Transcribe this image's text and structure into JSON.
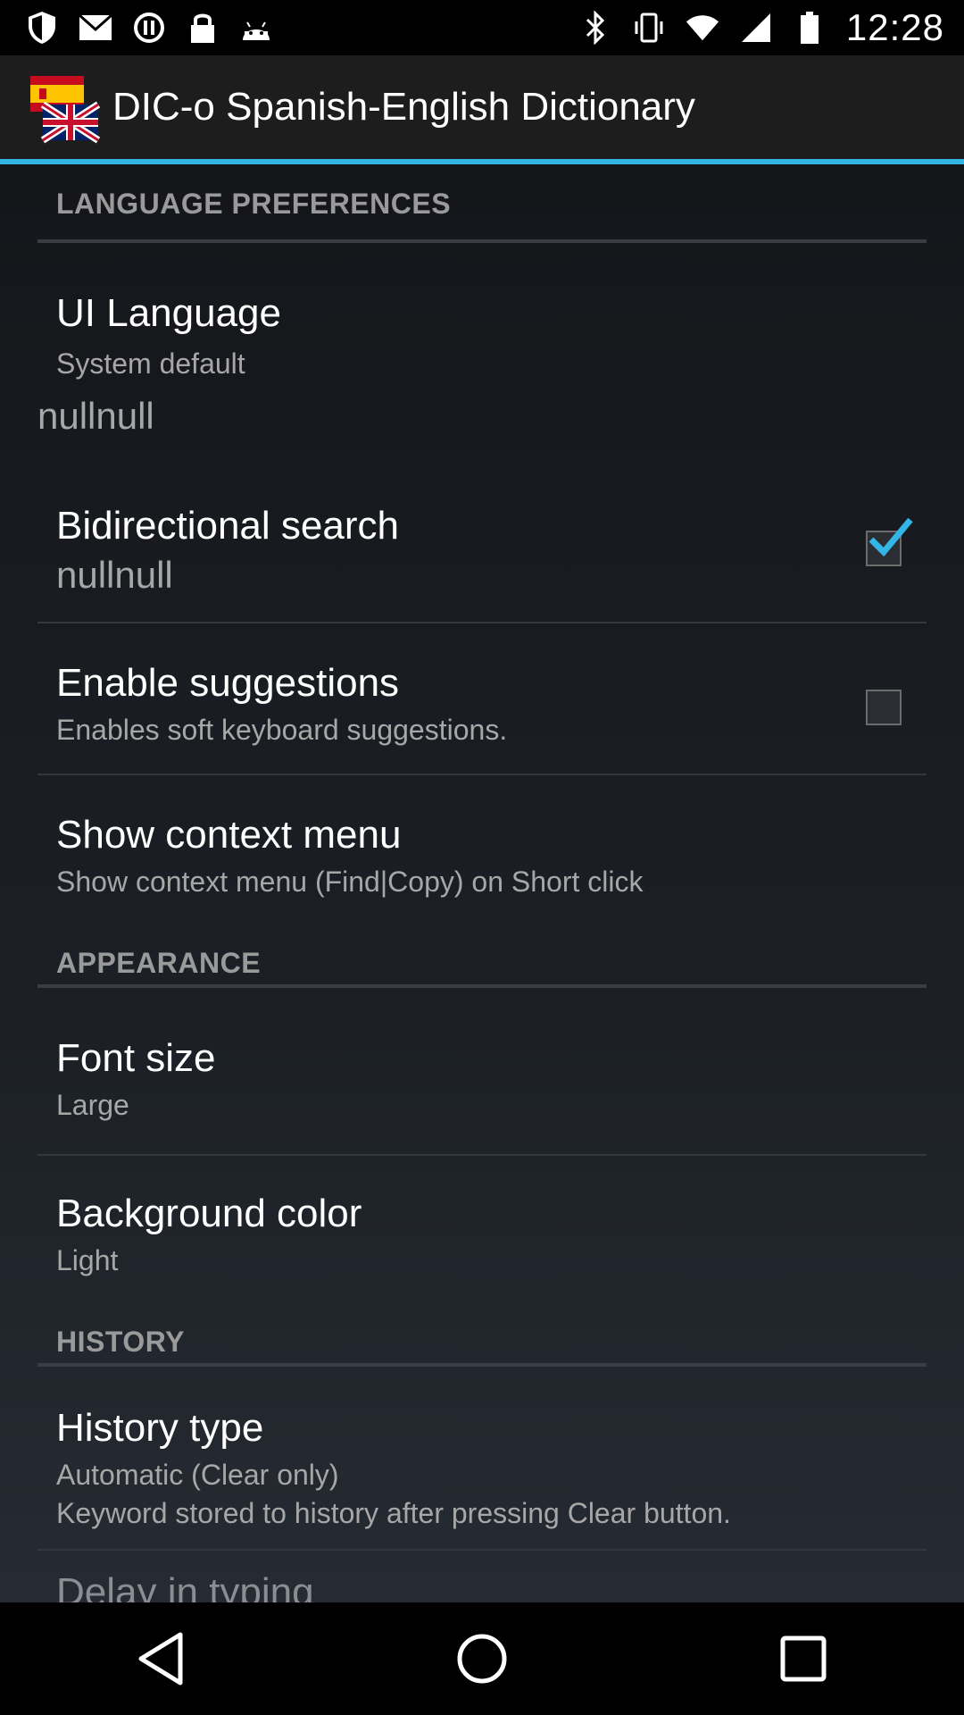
{
  "status_bar": {
    "time": "12:28",
    "left_icons": [
      "shield-icon",
      "gmail-icon",
      "sync-icon",
      "lock-icon",
      "android-icon"
    ],
    "right_icons": [
      "bluetooth-icon",
      "vibrate-icon",
      "wifi-icon",
      "signal-icon",
      "battery-icon"
    ]
  },
  "app_bar": {
    "title": "DIC-o Spanish-English Dictionary",
    "icon": "flags-icon",
    "accent": "#33b5e5"
  },
  "sections": {
    "language": {
      "header": "LANGUAGE PREFERENCES",
      "ui_language": {
        "title": "UI Language",
        "summary": "System default"
      },
      "nullnull_row": {
        "text": "nullnull"
      },
      "bidirectional": {
        "title": "Bidirectional search",
        "summary": "nullnull",
        "checked": true
      },
      "suggestions": {
        "title": "Enable suggestions",
        "summary": "Enables soft keyboard suggestions.",
        "checked": false
      },
      "context_menu": {
        "title": "Show context menu",
        "summary": "Show context menu (Find|Copy) on Short click"
      }
    },
    "appearance": {
      "header": "APPEARANCE",
      "font_size": {
        "title": "Font size",
        "summary": "Large"
      },
      "background_color": {
        "title": "Background color",
        "summary": "Light"
      }
    },
    "history": {
      "header": "HISTORY",
      "history_type": {
        "title": "History type",
        "summary_line1": "Automatic (Clear only)",
        "summary_line2": "Keyword stored to history after pressing Clear button."
      },
      "delay": {
        "title": "Delay in typing"
      }
    }
  },
  "nav_bar": {
    "back": "back-icon",
    "home": "home-icon",
    "recents": "recents-icon"
  }
}
